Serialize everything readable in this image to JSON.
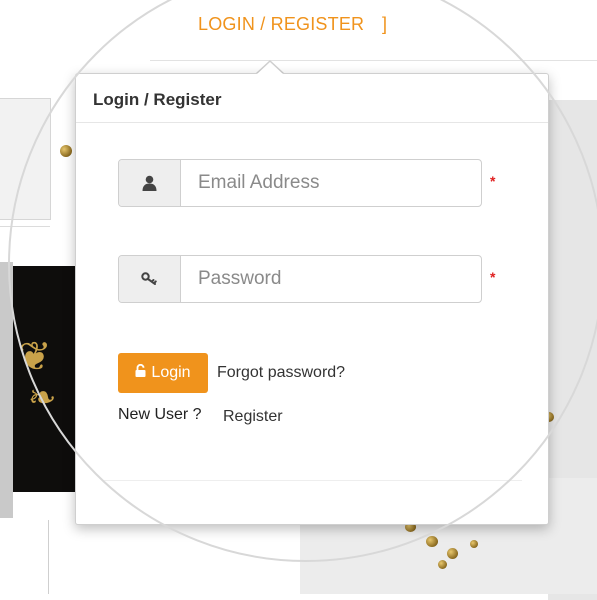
{
  "nav": {
    "login_register_link": "LOGIN / REGISTER",
    "bracket": "]"
  },
  "dropdown": {
    "title": "Login / Register",
    "email": {
      "placeholder": "Email Address",
      "value": "",
      "icon": "user-icon",
      "required_mark": "*"
    },
    "password": {
      "placeholder": "Password",
      "value": "",
      "icon": "key-icon",
      "required_mark": "*"
    },
    "login_button": {
      "label": "Login",
      "icon": "lock-icon"
    },
    "forgot_password_link": "Forgot password?",
    "new_user_text": "New User ?",
    "register_link": "Register"
  },
  "colors": {
    "accent": "#f0931c",
    "required": "#e02020",
    "addon_bg": "#eeeeee",
    "text": "#333333"
  }
}
